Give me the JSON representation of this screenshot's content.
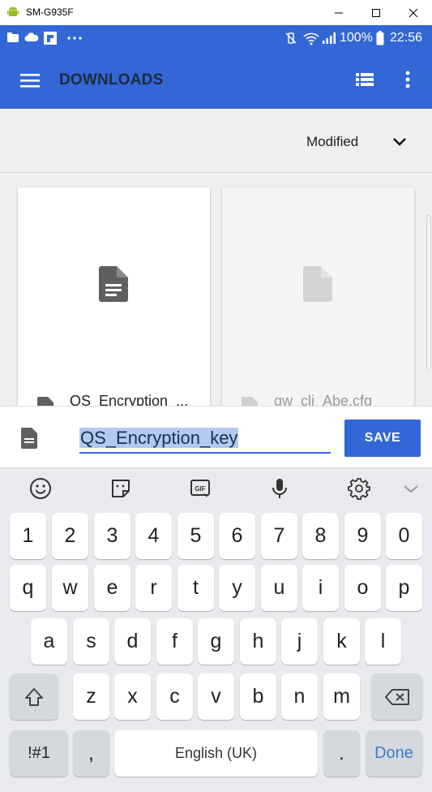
{
  "window": {
    "title": "SM-G935F"
  },
  "status_bar": {
    "battery": "100%",
    "time": "22:56"
  },
  "app_bar": {
    "title": "DOWNLOADS"
  },
  "sort": {
    "label": "Modified"
  },
  "files": [
    {
      "name": "QS_Encryption_..."
    },
    {
      "name": "gw_cli_Abe.cfg"
    }
  ],
  "rename": {
    "value": "QS_Encryption_key",
    "save_label": "SAVE"
  },
  "keyboard": {
    "row_numbers": [
      "1",
      "2",
      "3",
      "4",
      "5",
      "6",
      "7",
      "8",
      "9",
      "0"
    ],
    "row_1": [
      "q",
      "w",
      "e",
      "r",
      "t",
      "y",
      "u",
      "i",
      "o",
      "p"
    ],
    "row_2": [
      "a",
      "s",
      "d",
      "f",
      "g",
      "h",
      "j",
      "k",
      "l"
    ],
    "row_3": [
      "z",
      "x",
      "c",
      "v",
      "b",
      "n",
      "m"
    ],
    "symbols_label": "!#1",
    "comma_label": ",",
    "space_label": "English (UK)",
    "period_label": ".",
    "done_label": "Done"
  },
  "colors": {
    "accent": "#3367d6",
    "done_text": "#3a7dc9"
  }
}
